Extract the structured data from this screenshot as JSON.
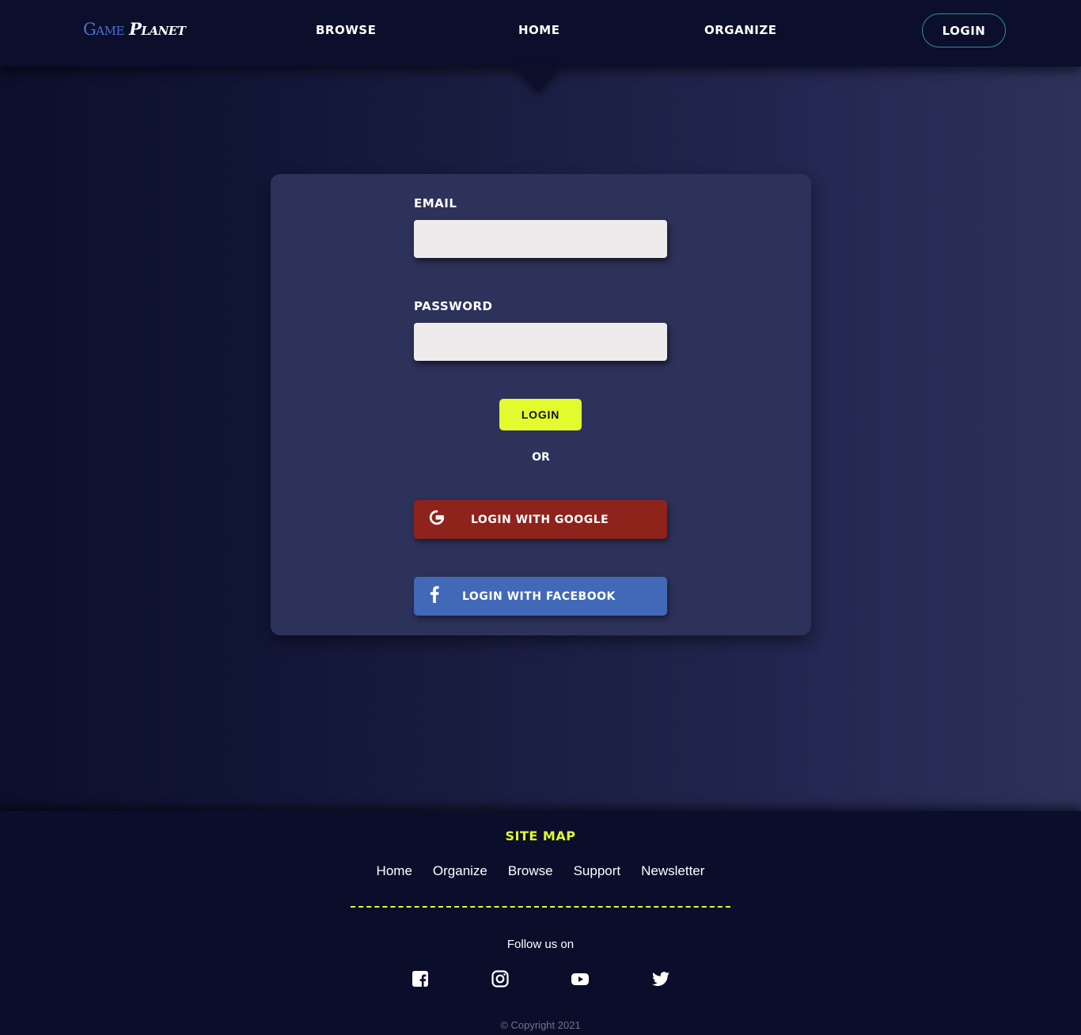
{
  "header": {
    "logo_game": "Game",
    "logo_planet": "Planet",
    "nav": {
      "browse": "BROWSE",
      "home": "HOME",
      "organize": "ORGANIZE",
      "login": "LOGIN"
    }
  },
  "login_form": {
    "email_label": "EMAIL",
    "email_value": "",
    "password_label": "PASSWORD",
    "password_value": "",
    "login_button": "LOGIN",
    "or_text": "OR",
    "google_button": "LOGIN WITH GOOGLE",
    "facebook_button": "LOGIN WITH FACEBOOK"
  },
  "footer": {
    "sitemap_title": "SITE MAP",
    "links": [
      "Home",
      "Organize",
      "Browse",
      "Support",
      "Newsletter"
    ],
    "follow_text": "Follow us on",
    "social_icons": [
      "facebook-icon",
      "instagram-icon",
      "youtube-icon",
      "twitter-icon"
    ],
    "copyright": "© Copyright 2021"
  },
  "colors": {
    "accent": "#e1fb2c",
    "background": "#0b0f2b",
    "card": "#2d325b",
    "google": "#8e231c",
    "facebook": "#4268b8"
  }
}
